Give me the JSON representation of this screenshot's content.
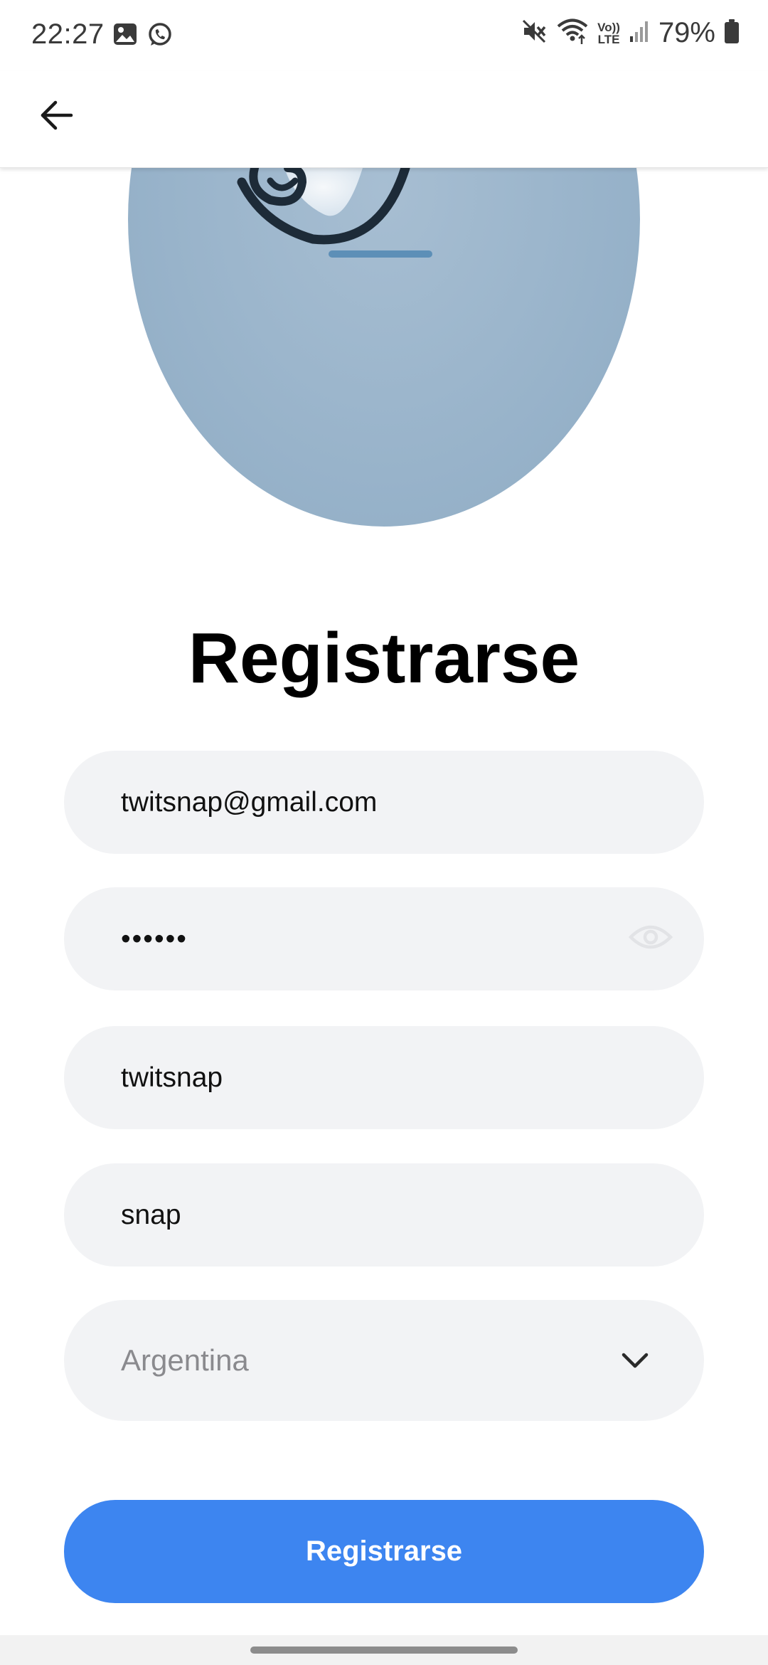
{
  "status_bar": {
    "time": "22:27",
    "battery": "79%",
    "left_icons": [
      "image-icon",
      "whatsapp-icon"
    ],
    "right_icons": [
      "mute-icon",
      "wifi-icon",
      "volte-icon",
      "signal-icon",
      "battery-icon"
    ],
    "volte_top": "Vo))",
    "volte_bottom": "LTE"
  },
  "app_bar": {
    "back_icon": "arrow-left-icon"
  },
  "page": {
    "title": "Registrarse"
  },
  "form": {
    "email": {
      "value": "twitsnap@gmail.com"
    },
    "password": {
      "value": "••••••",
      "toggle_icon": "eye-icon"
    },
    "username": {
      "value": "twitsnap"
    },
    "name": {
      "value": "snap"
    },
    "country": {
      "value": "Argentina",
      "icon": "chevron-down-icon"
    },
    "submit_label": "Registrarse"
  },
  "colors": {
    "primary": "#3d85f0",
    "field_bg": "#f2f3f5",
    "logo_bg": "#98b3ca"
  }
}
